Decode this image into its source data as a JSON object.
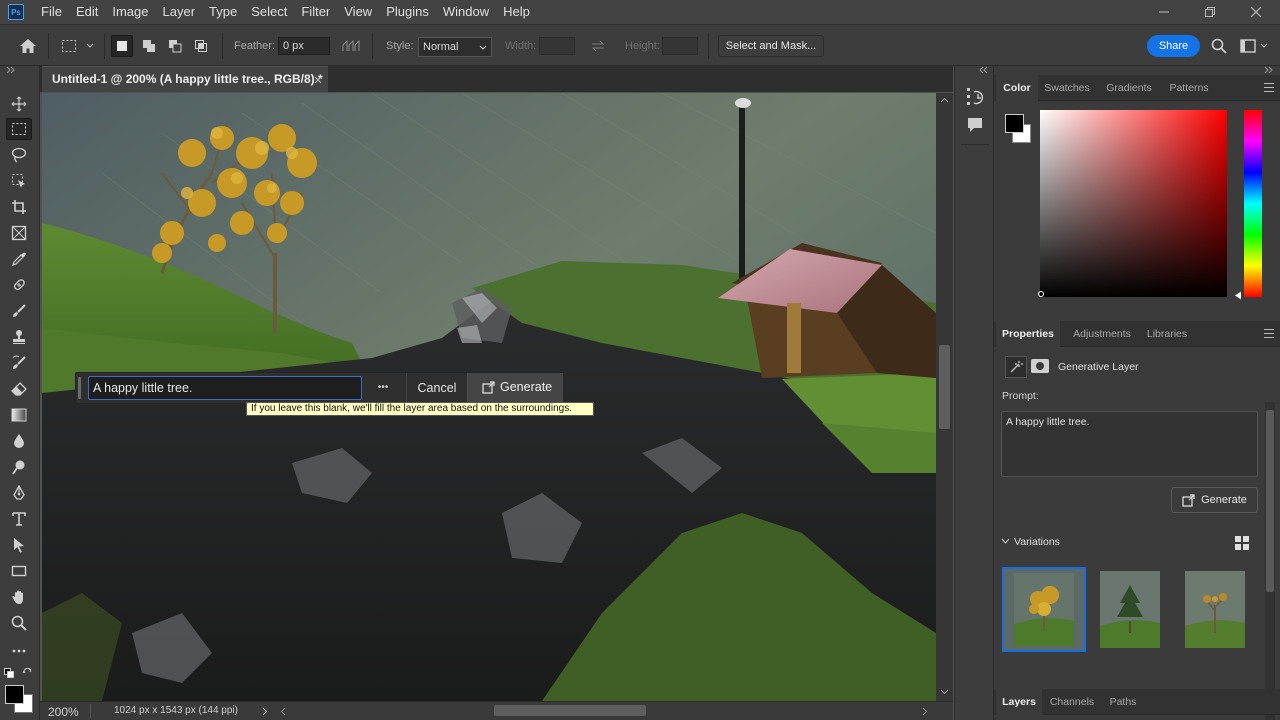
{
  "app": {
    "logo": "Ps"
  },
  "menu": [
    "File",
    "Edit",
    "Image",
    "Layer",
    "Type",
    "Select",
    "Filter",
    "View",
    "Plugins",
    "Window",
    "Help"
  ],
  "options": {
    "feather_label": "Feather:",
    "feather_value": "0 px",
    "style_label": "Style:",
    "style_value": "Normal",
    "width_label": "Width:",
    "height_label": "Height:",
    "select_mask": "Select and Mask...",
    "share": "Share"
  },
  "document": {
    "tab_title": "Untitled-1 @ 200% (A happy little tree., RGB/8) *",
    "zoom": "200%",
    "doc_info": "1024 px x 1543 px (144 ppi)"
  },
  "gen_fill": {
    "prompt_value": "A happy little tree.",
    "more": "•••",
    "cancel": "Cancel",
    "generate": "Generate",
    "tooltip": "If you leave this blank, we'll fill the layer area based on the surroundings."
  },
  "color_panel": {
    "tabs": [
      "Color",
      "Swatches",
      "Gradients",
      "Patterns"
    ],
    "foreground": "#000000",
    "background": "#ffffff",
    "hue": "#ff0000"
  },
  "properties_panel": {
    "tabs": [
      "Properties",
      "Adjustments",
      "Libraries"
    ],
    "layer_type": "Generative Layer",
    "prompt_label": "Prompt:",
    "prompt_value": "A happy little tree.",
    "generate": "Generate",
    "variations_label": "Variations",
    "variations_count": 3,
    "selected_variation": 1
  },
  "layers_panel": {
    "tabs": [
      "Layers",
      "Channels",
      "Paths"
    ]
  },
  "colors": {
    "accent": "#1473e6",
    "selection_blue": "#1a6fe0",
    "tooltip_bg": "#ffffc4"
  }
}
